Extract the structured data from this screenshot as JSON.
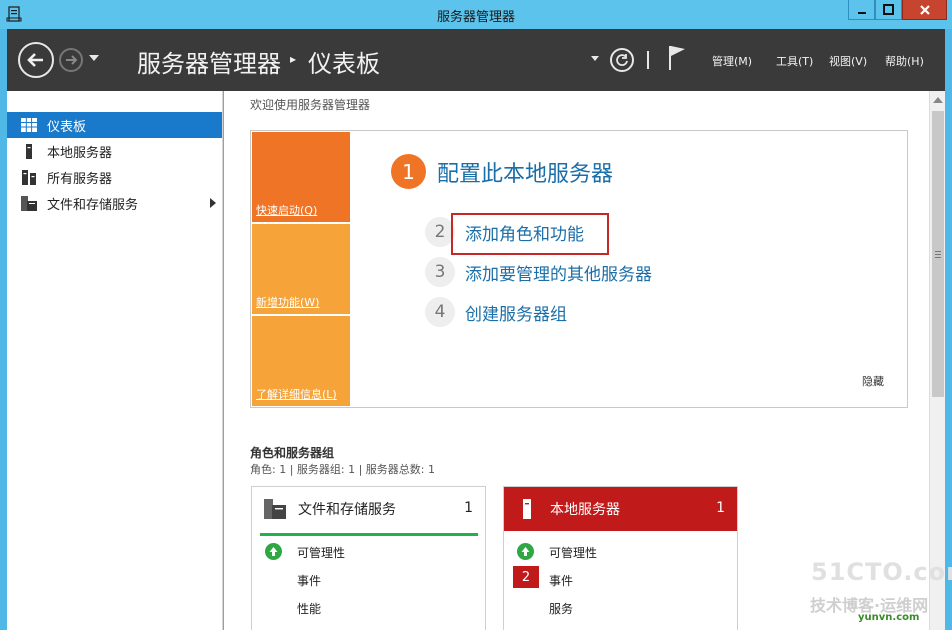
{
  "window": {
    "title": "服务器管理器"
  },
  "header": {
    "breadcrumb_root": "服务器管理器",
    "breadcrumb_sep": "▸",
    "breadcrumb_page": "仪表板",
    "menus": [
      {
        "label": "管理(M)"
      },
      {
        "label": "工具(T)"
      },
      {
        "label": "视图(V)"
      },
      {
        "label": "帮助(H)"
      }
    ]
  },
  "sidebar": {
    "items": [
      {
        "label": "仪表板",
        "icon": "dashboard-grid-icon",
        "active": true
      },
      {
        "label": "本地服务器",
        "icon": "server-icon"
      },
      {
        "label": "所有服务器",
        "icon": "servers-icon"
      },
      {
        "label": "文件和存储服务",
        "icon": "file-storage-icon",
        "expandable": true
      }
    ]
  },
  "welcome": {
    "title": "欢迎使用服务器管理器",
    "tiles": [
      {
        "label": "快速启动(Q)",
        "color": "#f07426"
      },
      {
        "label": "新增功能(W)",
        "color": "#f6a43a"
      },
      {
        "label": "了解详细信息(L)",
        "color": "#f6a43a"
      }
    ],
    "steps": [
      {
        "num": "1",
        "label": "配置此本地服务器"
      },
      {
        "num": "2",
        "label": "添加角色和功能"
      },
      {
        "num": "3",
        "label": "添加要管理的其他服务器"
      },
      {
        "num": "4",
        "label": "创建服务器组"
      }
    ],
    "hide_label": "隐藏"
  },
  "roles": {
    "title": "角色和服务器组",
    "subtitle": "角色: 1 | 服务器组: 1 | 服务器总数: 1",
    "cards": [
      {
        "title": "文件和存储服务",
        "count": "1",
        "header_color": "#ffffff",
        "rows": [
          {
            "label": "可管理性",
            "status": "ok"
          },
          {
            "label": "事件"
          },
          {
            "label": "性能"
          }
        ]
      },
      {
        "title": "本地服务器",
        "count": "1",
        "header_color": "#c11a1a",
        "rows": [
          {
            "label": "可管理性",
            "status": "ok"
          },
          {
            "label": "事件",
            "badge": "2"
          },
          {
            "label": "服务"
          }
        ]
      }
    ]
  },
  "watermark": {
    "line1": "51CTO.com",
    "line2": "技术博客·运维网",
    "line3": "yunvn.com"
  },
  "colors": {
    "accent": "#1979ca",
    "orange": "#f07426",
    "light_orange": "#f6a43a",
    "red": "#c11a1a",
    "green": "#22b14c"
  }
}
